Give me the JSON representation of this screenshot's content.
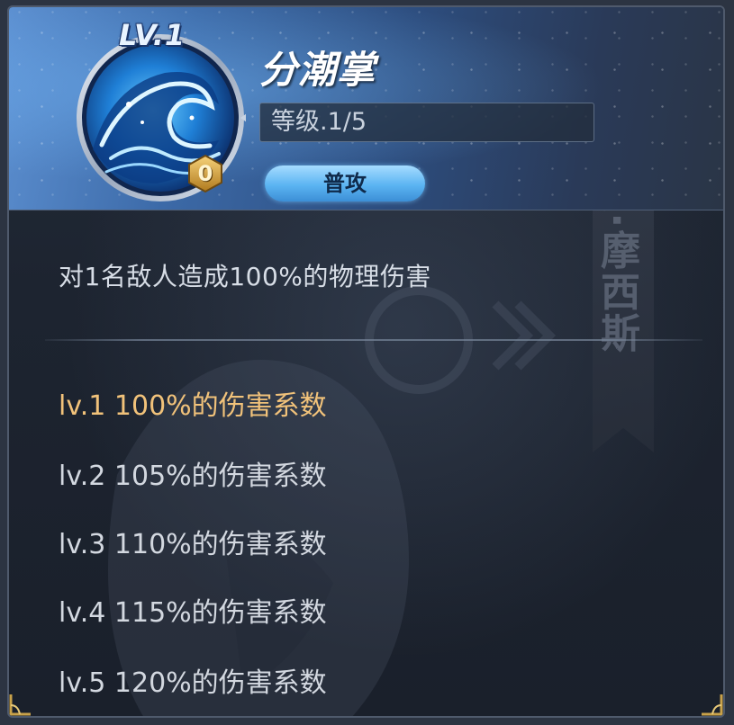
{
  "skill": {
    "level_badge": "LV.1",
    "cost": "0",
    "name": "分潮掌",
    "level_progress": "等级.1/5",
    "type_tag": "普攻",
    "description": "对1名敌人造成100%的物理伤害"
  },
  "side_banner": {
    "text": "B白鲸座·摩西斯"
  },
  "levels": [
    {
      "text": "lv.1 100%的伤害系数",
      "current": true
    },
    {
      "text": "lv.2 105%的伤害系数",
      "current": false
    },
    {
      "text": "lv.3 110%的伤害系数",
      "current": false
    },
    {
      "text": "lv.4 115%的伤害系数",
      "current": false
    },
    {
      "text": "lv.5 120%的伤害系数",
      "current": false
    }
  ],
  "colors": {
    "current_level": "#f1c27a",
    "normal_text": "#d3d8e0",
    "pill": "#5bb4f2",
    "frame_gold": "#c9a24a"
  },
  "icons": {
    "skill_icon": "wave-icon",
    "cost_icon": "hexagon-cost-icon"
  }
}
